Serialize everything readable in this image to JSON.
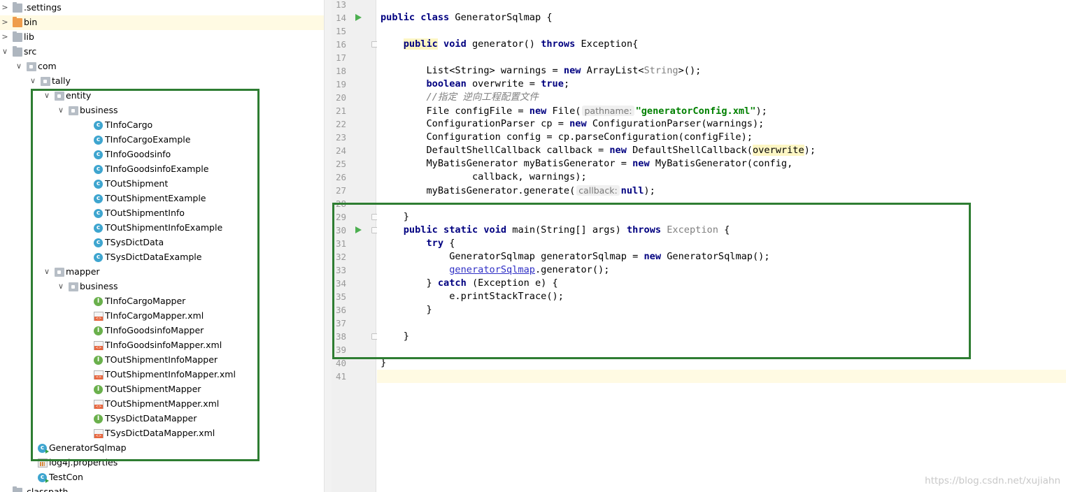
{
  "tree": {
    "rows": [
      {
        "label": ".settings",
        "type": "folder",
        "depth": 0,
        "chevron": "chevron-right-icon",
        "name": "tree-folder-settings"
      },
      {
        "label": "bin",
        "type": "folder-orange",
        "depth": 0,
        "chevron": "chevron-right-icon",
        "name": "tree-folder-bin",
        "selected": true
      },
      {
        "label": "lib",
        "type": "folder",
        "depth": 0,
        "chevron": "chevron-right-icon",
        "name": "tree-folder-lib"
      },
      {
        "label": "src",
        "type": "folder",
        "depth": 0,
        "chevron": "chevron-down-icon",
        "name": "tree-folder-src"
      },
      {
        "label": "com",
        "type": "package",
        "depth": 1,
        "chevron": "chevron-down-icon",
        "name": "tree-package-com"
      },
      {
        "label": "tally",
        "type": "package",
        "depth": 2,
        "chevron": "chevron-down-icon",
        "name": "tree-package-tally"
      },
      {
        "label": "entity",
        "type": "package",
        "depth": 3,
        "chevron": "chevron-down-icon",
        "name": "tree-package-entity"
      },
      {
        "label": "business",
        "type": "package",
        "depth": 4,
        "chevron": "chevron-down-icon",
        "name": "tree-package-entity-business"
      },
      {
        "label": "TInfoCargo",
        "type": "class",
        "depth": 5,
        "name": "tree-class-tinfocargo"
      },
      {
        "label": "TInfoCargoExample",
        "type": "class",
        "depth": 5,
        "name": "tree-class-tinfocargoexample"
      },
      {
        "label": "TInfoGoodsinfo",
        "type": "class",
        "depth": 5,
        "name": "tree-class-tinfogoodsinfo"
      },
      {
        "label": "TInfoGoodsinfoExample",
        "type": "class",
        "depth": 5,
        "name": "tree-class-tinfogoodsinfoexample"
      },
      {
        "label": "TOutShipment",
        "type": "class",
        "depth": 5,
        "name": "tree-class-toutshipment"
      },
      {
        "label": "TOutShipmentExample",
        "type": "class",
        "depth": 5,
        "name": "tree-class-toutshipmentexample"
      },
      {
        "label": "TOutShipmentInfo",
        "type": "class",
        "depth": 5,
        "name": "tree-class-toutshipmentinfo"
      },
      {
        "label": "TOutShipmentInfoExample",
        "type": "class",
        "depth": 5,
        "name": "tree-class-toutshipmentinfoexample"
      },
      {
        "label": "TSysDictData",
        "type": "class",
        "depth": 5,
        "name": "tree-class-tsysdictdata"
      },
      {
        "label": "TSysDictDataExample",
        "type": "class",
        "depth": 5,
        "name": "tree-class-tsysdictdataexample"
      },
      {
        "label": "mapper",
        "type": "package",
        "depth": 3,
        "chevron": "chevron-down-icon",
        "name": "tree-package-mapper"
      },
      {
        "label": "business",
        "type": "package",
        "depth": 4,
        "chevron": "chevron-down-icon",
        "name": "tree-package-mapper-business"
      },
      {
        "label": "TInfoCargoMapper",
        "type": "interface",
        "depth": 5,
        "name": "tree-interface-tinfocargomapper"
      },
      {
        "label": "TInfoCargoMapper.xml",
        "type": "xml",
        "depth": 5,
        "name": "tree-xml-tinfocargomapper"
      },
      {
        "label": "TInfoGoodsinfoMapper",
        "type": "interface",
        "depth": 5,
        "name": "tree-interface-tinfogoodsinfomapper"
      },
      {
        "label": "TInfoGoodsinfoMapper.xml",
        "type": "xml",
        "depth": 5,
        "name": "tree-xml-tinfogoodsinfomapper"
      },
      {
        "label": "TOutShipmentInfoMapper",
        "type": "interface",
        "depth": 5,
        "name": "tree-interface-toutshipmentinfomapper"
      },
      {
        "label": "TOutShipmentInfoMapper.xml",
        "type": "xml",
        "depth": 5,
        "name": "tree-xml-toutshipmentinfomapper"
      },
      {
        "label": "TOutShipmentMapper",
        "type": "interface",
        "depth": 5,
        "name": "tree-interface-toutshipmentmapper"
      },
      {
        "label": "TOutShipmentMapper.xml",
        "type": "xml",
        "depth": 5,
        "name": "tree-xml-toutshipmentmapper"
      },
      {
        "label": "TSysDictDataMapper",
        "type": "interface",
        "depth": 5,
        "name": "tree-interface-tsysdictdatamapper"
      },
      {
        "label": "TSysDictDataMapper.xml",
        "type": "xml",
        "depth": 5,
        "name": "tree-xml-tsysdictdatamapper"
      },
      {
        "label": "GeneratorSqlmap",
        "type": "class-main",
        "depth": 1,
        "name": "tree-class-generatorsqlmap"
      },
      {
        "label": "log4j.properties",
        "type": "properties",
        "depth": 1,
        "name": "tree-file-log4j-properties"
      },
      {
        "label": "TestCon",
        "type": "class-main",
        "depth": 1,
        "name": "tree-class-testcon"
      },
      {
        "label": ".classpath",
        "type": "folder",
        "depth": 0,
        "name": "tree-file-classpath"
      }
    ]
  },
  "editor": {
    "first_line": 13,
    "current_line": 41,
    "run_markers": [
      14,
      30
    ],
    "fold_markers": [
      16,
      29,
      30,
      38
    ],
    "lines": [
      {
        "n": 13,
        "tokens": []
      },
      {
        "n": 14,
        "tokens": [
          [
            "kw",
            "public "
          ],
          [
            "kw",
            "class "
          ],
          [
            "t",
            "GeneratorSqlmap {"
          ]
        ]
      },
      {
        "n": 15,
        "tokens": []
      },
      {
        "n": 16,
        "tokens": [
          [
            "t",
            "    "
          ],
          [
            "hlkw",
            "public"
          ],
          [
            "t",
            " "
          ],
          [
            "kw",
            "void "
          ],
          [
            "t",
            "generator() "
          ],
          [
            "kw",
            "throws "
          ],
          [
            "t",
            "Exception{"
          ]
        ]
      },
      {
        "n": 17,
        "tokens": []
      },
      {
        "n": 18,
        "tokens": [
          [
            "t",
            "        List<String> warnings = "
          ],
          [
            "kw",
            "new "
          ],
          [
            "t",
            "ArrayList<"
          ],
          [
            "gen",
            "String"
          ],
          [
            "t",
            ">();"
          ]
        ]
      },
      {
        "n": 19,
        "tokens": [
          [
            "t",
            "        "
          ],
          [
            "kw",
            "boolean "
          ],
          [
            "t",
            "overwrite = "
          ],
          [
            "kw",
            "true"
          ],
          [
            "t",
            ";"
          ]
        ]
      },
      {
        "n": 20,
        "tokens": [
          [
            "t",
            "        "
          ],
          [
            "cmt",
            "//指定 逆向工程配置文件"
          ]
        ]
      },
      {
        "n": 21,
        "tokens": [
          [
            "t",
            "        File configFile = "
          ],
          [
            "kw",
            "new "
          ],
          [
            "t",
            "File("
          ],
          [
            "hint",
            "pathname:"
          ],
          [
            "str",
            "\"generatorConfig.xml\""
          ],
          [
            "t",
            ");"
          ]
        ]
      },
      {
        "n": 22,
        "tokens": [
          [
            "t",
            "        ConfigurationParser cp = "
          ],
          [
            "kw",
            "new "
          ],
          [
            "t",
            "ConfigurationParser(warnings);"
          ]
        ]
      },
      {
        "n": 23,
        "tokens": [
          [
            "t",
            "        Configuration config = cp.parseConfiguration(configFile);"
          ]
        ]
      },
      {
        "n": 24,
        "tokens": [
          [
            "t",
            "        DefaultShellCallback callback = "
          ],
          [
            "kw",
            "new "
          ],
          [
            "t",
            "DefaultShellCallback("
          ],
          [
            "hl",
            "overwrite"
          ],
          [
            "t",
            ");"
          ]
        ]
      },
      {
        "n": 25,
        "tokens": [
          [
            "t",
            "        MyBatisGenerator myBatisGenerator = "
          ],
          [
            "kw",
            "new "
          ],
          [
            "t",
            "MyBatisGenerator(config,"
          ]
        ]
      },
      {
        "n": 26,
        "tokens": [
          [
            "t",
            "                callback, warnings);"
          ]
        ]
      },
      {
        "n": 27,
        "tokens": [
          [
            "t",
            "        myBatisGenerator.generate("
          ],
          [
            "hint",
            "callback:"
          ],
          [
            "kw",
            "null"
          ],
          [
            "t",
            ");"
          ]
        ]
      },
      {
        "n": 28,
        "tokens": []
      },
      {
        "n": 29,
        "tokens": [
          [
            "t",
            "    }"
          ]
        ]
      },
      {
        "n": 30,
        "tokens": [
          [
            "t",
            "    "
          ],
          [
            "kw",
            "public "
          ],
          [
            "kw",
            "static "
          ],
          [
            "kw",
            "void "
          ],
          [
            "t",
            "main(String[] args) "
          ],
          [
            "kw",
            "throws "
          ],
          [
            "gen",
            "Exception"
          ],
          [
            "t",
            " {"
          ]
        ]
      },
      {
        "n": 31,
        "tokens": [
          [
            "t",
            "        "
          ],
          [
            "kw",
            "try "
          ],
          [
            "t",
            "{"
          ]
        ]
      },
      {
        "n": 32,
        "tokens": [
          [
            "t",
            "            GeneratorSqlmap generatorSqlmap = "
          ],
          [
            "kw",
            "new "
          ],
          [
            "t",
            "GeneratorSqlmap();"
          ]
        ]
      },
      {
        "n": 33,
        "tokens": [
          [
            "t",
            "            "
          ],
          [
            "link",
            "generatorSqlmap"
          ],
          [
            "t",
            ".generator();"
          ]
        ]
      },
      {
        "n": 34,
        "tokens": [
          [
            "t",
            "        } "
          ],
          [
            "kw",
            "catch "
          ],
          [
            "t",
            "(Exception e) {"
          ]
        ]
      },
      {
        "n": 35,
        "tokens": [
          [
            "t",
            "            e.printStackTrace();"
          ]
        ]
      },
      {
        "n": 36,
        "tokens": [
          [
            "t",
            "        }"
          ]
        ]
      },
      {
        "n": 37,
        "tokens": []
      },
      {
        "n": 38,
        "tokens": [
          [
            "t",
            "    }"
          ]
        ]
      },
      {
        "n": 39,
        "tokens": []
      },
      {
        "n": 40,
        "tokens": [
          [
            "t",
            "}"
          ]
        ]
      },
      {
        "n": 41,
        "tokens": []
      }
    ]
  },
  "watermark": "https://blog.csdn.net/xujiahn",
  "colors": {
    "annotation_box": "#2e7d32",
    "keyword": "#000080",
    "string": "#008000",
    "comment": "#808080",
    "current_line": "#fffae3",
    "run_marker": "#4caf50"
  }
}
